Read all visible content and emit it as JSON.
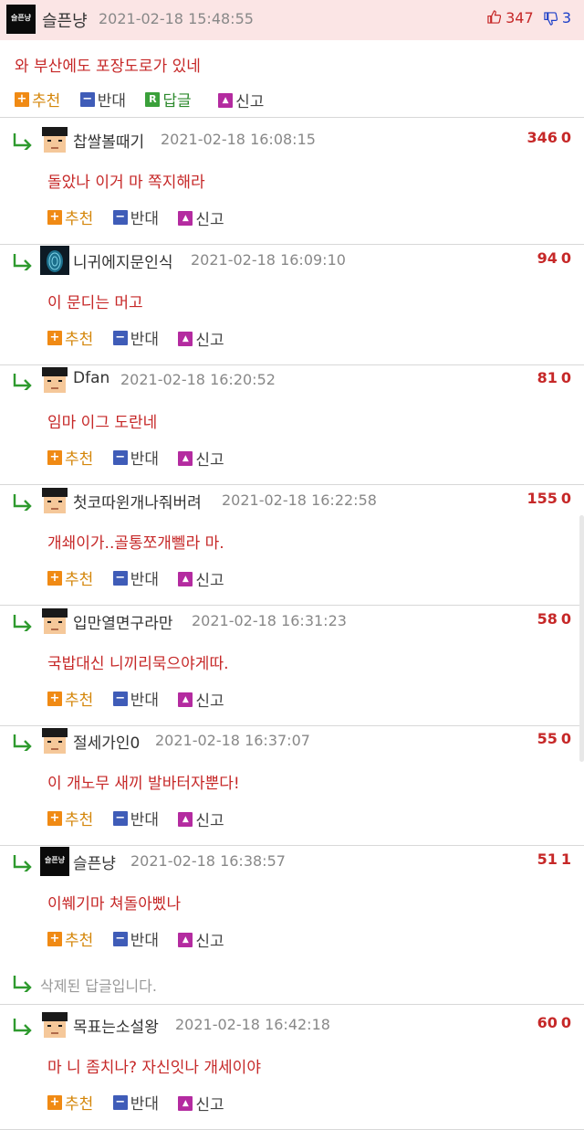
{
  "post": {
    "username": "슬픈냥",
    "avatar_text": "슬픈냥",
    "date": "2021-02-18 15:48:55",
    "up_votes": "347",
    "down_votes": "3",
    "text": "와 부산에도 포장도로가 있네",
    "actions": {
      "recommend": "추천",
      "oppose": "반대",
      "reply": "답글",
      "report": "신고"
    }
  },
  "actions": {
    "recommend": "추천",
    "oppose": "반대",
    "report": "신고"
  },
  "icons": {
    "reply_arrow": "reply-arrow-icon",
    "thumb_up": "thumbs-up-icon",
    "thumb_down": "thumbs-down-icon"
  },
  "colors": {
    "header_bg": "#fbe5e5",
    "comment_text": "#c62828",
    "up_vote": "#c62828",
    "down_vote": "#1e40c8",
    "reply_arrow": "#2e9a2e"
  },
  "comments": [
    {
      "username": "찹쌀볼때기",
      "date": "2021-02-18 16:08:15",
      "up": "346",
      "down": "0",
      "text": "돌았나 이거 마 쪽지해라"
    },
    {
      "username": "니귀에지문인식",
      "date": "2021-02-18 16:09:10",
      "up": "94",
      "down": "0",
      "text": "이 문디는 머고"
    },
    {
      "username": "Dfan",
      "date": "2021-02-18 16:20:52",
      "up": "81",
      "down": "0",
      "text": "임마 이그 도란네"
    },
    {
      "username": "첫코따윈개나줘버려",
      "date": "2021-02-18 16:22:58",
      "up": "155",
      "down": "0",
      "text": "개쇄이가..골통쪼개뻴라 마."
    },
    {
      "username": "입만열면구라만",
      "date": "2021-02-18 16:31:23",
      "up": "58",
      "down": "0",
      "text": "국밥대신 니끼리묵으야게따."
    },
    {
      "username": "절세가인0",
      "date": "2021-02-18 16:37:07",
      "up": "55",
      "down": "0",
      "text": "이 개노무 새끼 발바터자뿐다!"
    },
    {
      "username": "슬픈냥",
      "avatar_text": "슬픈냥",
      "date": "2021-02-18 16:38:57",
      "up": "51",
      "down": "1",
      "text": "이쒜기마 쳐돌아삤나"
    },
    {
      "username": "목표는소설왕",
      "date": "2021-02-18 16:42:18",
      "up": "60",
      "down": "0",
      "text": "마 니 좀치나? 자신잇나 개세이야"
    }
  ],
  "deleted_reply": "삭제된 답글입니다."
}
